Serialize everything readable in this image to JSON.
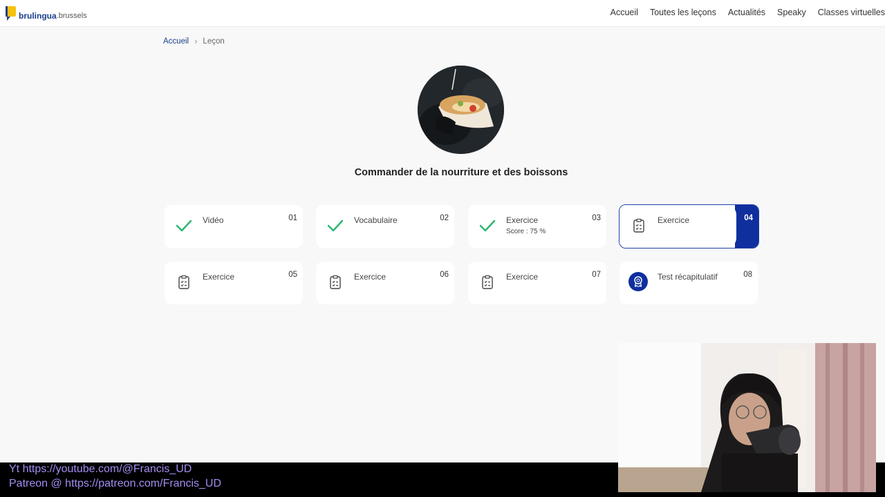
{
  "header": {
    "logo": {
      "main": "brulingua",
      "sub": ".brussels"
    },
    "nav": [
      "Accueil",
      "Toutes les leçons",
      "Actualités",
      "Speaky",
      "Classes virtuelles"
    ]
  },
  "breadcrumb": {
    "home": "Accueil",
    "separator": ">",
    "current": "Leçon"
  },
  "lesson": {
    "image": "food-sandwich-photo",
    "title": "Commander de la nourriture et des boissons"
  },
  "cards": [
    {
      "num": "01",
      "label": "Vidéo",
      "icon": "check-icon",
      "status": "done"
    },
    {
      "num": "02",
      "label": "Vocabulaire",
      "icon": "check-icon",
      "status": "done"
    },
    {
      "num": "03",
      "label": "Exercice",
      "score": "Score : 75 %",
      "icon": "check-icon",
      "status": "done"
    },
    {
      "num": "04",
      "label": "Exercice",
      "icon": "clipboard-icon",
      "status": "active"
    },
    {
      "num": "05",
      "label": "Exercice",
      "icon": "clipboard-icon",
      "status": "todo"
    },
    {
      "num": "06",
      "label": "Exercice",
      "icon": "clipboard-icon",
      "status": "todo"
    },
    {
      "num": "07",
      "label": "Exercice",
      "icon": "clipboard-icon",
      "status": "todo"
    },
    {
      "num": "08",
      "label": "Test récapitulatif",
      "icon": "award-icon",
      "status": "todo"
    }
  ],
  "overlay": {
    "youtube": "Yt https://youtube.com/@Francis_UD",
    "patreon": "Patreon @ https://patreon.com/Francis_UD"
  },
  "colors": {
    "brand": "#1a3f8c",
    "active": "#0f2f9e",
    "check": "#2bb673",
    "overlay_text": "#a58cf0"
  }
}
